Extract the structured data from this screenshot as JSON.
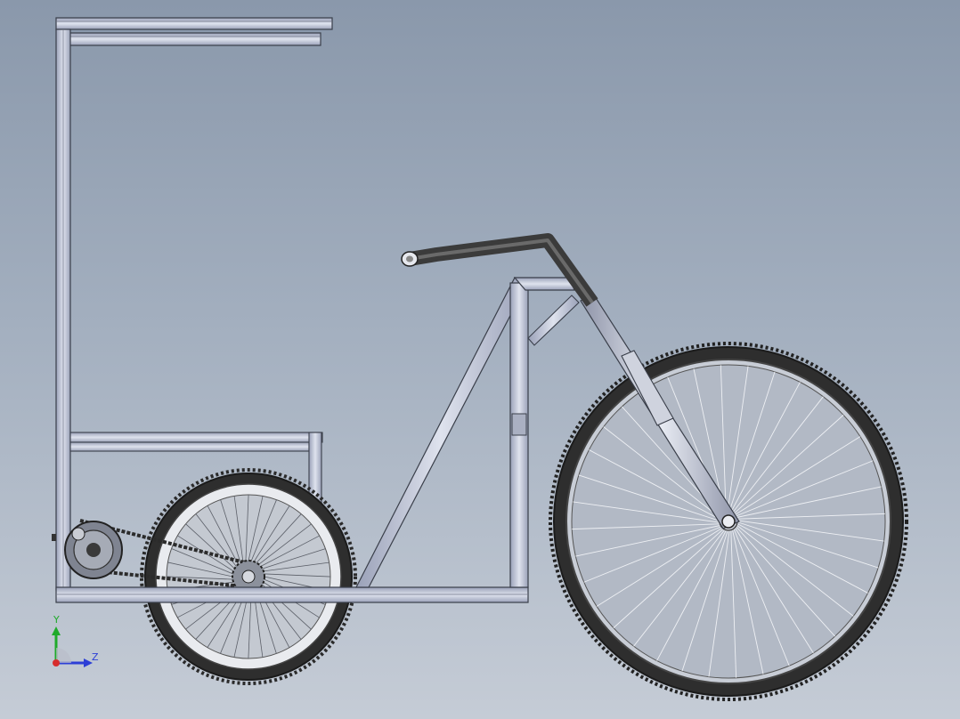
{
  "viewport": {
    "colors": {
      "background_top": "#8a98ab",
      "background_bottom": "#c5ccd6",
      "frame_fill": "#c3c9db",
      "frame_edge": "#3a3f4a",
      "tire": "#2a2a2a",
      "rim": "#e9ebef",
      "handlebar": "#3b3b3b"
    }
  },
  "triad": {
    "y_label": "Y",
    "z_label": "Z",
    "y_color": "#1faa2a",
    "z_color": "#2d3fd6",
    "x_color": "#d62d2d"
  },
  "model": {
    "parts": [
      "canopy-roof",
      "rear-frame",
      "cargo-frame",
      "base-frame",
      "seat-post",
      "down-tube",
      "head-tube-brace",
      "handlebar",
      "front-fork",
      "front-wheel",
      "rear-wheel",
      "chain",
      "drive-sprocket",
      "motor-hub"
    ]
  }
}
